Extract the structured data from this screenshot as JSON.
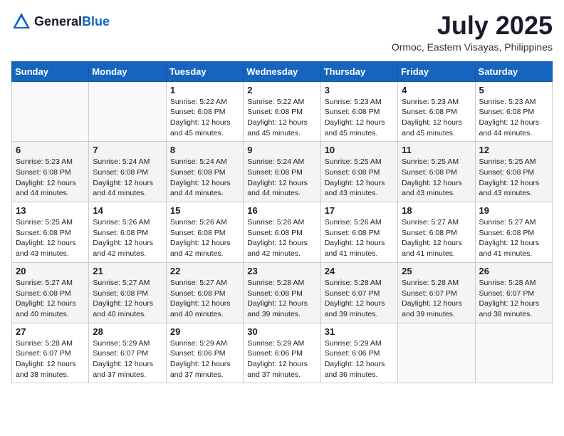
{
  "header": {
    "logo_general": "General",
    "logo_blue": "Blue",
    "month_year": "July 2025",
    "location": "Ormoc, Eastern Visayas, Philippines"
  },
  "columns": [
    "Sunday",
    "Monday",
    "Tuesday",
    "Wednesday",
    "Thursday",
    "Friday",
    "Saturday"
  ],
  "rows": [
    [
      {
        "day": "",
        "detail": ""
      },
      {
        "day": "",
        "detail": ""
      },
      {
        "day": "1",
        "detail": "Sunrise: 5:22 AM\nSunset: 6:08 PM\nDaylight: 12 hours and 45 minutes."
      },
      {
        "day": "2",
        "detail": "Sunrise: 5:22 AM\nSunset: 6:08 PM\nDaylight: 12 hours and 45 minutes."
      },
      {
        "day": "3",
        "detail": "Sunrise: 5:23 AM\nSunset: 6:08 PM\nDaylight: 12 hours and 45 minutes."
      },
      {
        "day": "4",
        "detail": "Sunrise: 5:23 AM\nSunset: 6:08 PM\nDaylight: 12 hours and 45 minutes."
      },
      {
        "day": "5",
        "detail": "Sunrise: 5:23 AM\nSunset: 6:08 PM\nDaylight: 12 hours and 44 minutes."
      }
    ],
    [
      {
        "day": "6",
        "detail": "Sunrise: 5:23 AM\nSunset: 6:08 PM\nDaylight: 12 hours and 44 minutes."
      },
      {
        "day": "7",
        "detail": "Sunrise: 5:24 AM\nSunset: 6:08 PM\nDaylight: 12 hours and 44 minutes."
      },
      {
        "day": "8",
        "detail": "Sunrise: 5:24 AM\nSunset: 6:08 PM\nDaylight: 12 hours and 44 minutes."
      },
      {
        "day": "9",
        "detail": "Sunrise: 5:24 AM\nSunset: 6:08 PM\nDaylight: 12 hours and 44 minutes."
      },
      {
        "day": "10",
        "detail": "Sunrise: 5:25 AM\nSunset: 6:08 PM\nDaylight: 12 hours and 43 minutes."
      },
      {
        "day": "11",
        "detail": "Sunrise: 5:25 AM\nSunset: 6:08 PM\nDaylight: 12 hours and 43 minutes."
      },
      {
        "day": "12",
        "detail": "Sunrise: 5:25 AM\nSunset: 6:08 PM\nDaylight: 12 hours and 43 minutes."
      }
    ],
    [
      {
        "day": "13",
        "detail": "Sunrise: 5:25 AM\nSunset: 6:08 PM\nDaylight: 12 hours and 43 minutes."
      },
      {
        "day": "14",
        "detail": "Sunrise: 5:26 AM\nSunset: 6:08 PM\nDaylight: 12 hours and 42 minutes."
      },
      {
        "day": "15",
        "detail": "Sunrise: 5:26 AM\nSunset: 6:08 PM\nDaylight: 12 hours and 42 minutes."
      },
      {
        "day": "16",
        "detail": "Sunrise: 5:26 AM\nSunset: 6:08 PM\nDaylight: 12 hours and 42 minutes."
      },
      {
        "day": "17",
        "detail": "Sunrise: 5:26 AM\nSunset: 6:08 PM\nDaylight: 12 hours and 41 minutes."
      },
      {
        "day": "18",
        "detail": "Sunrise: 5:27 AM\nSunset: 6:08 PM\nDaylight: 12 hours and 41 minutes."
      },
      {
        "day": "19",
        "detail": "Sunrise: 5:27 AM\nSunset: 6:08 PM\nDaylight: 12 hours and 41 minutes."
      }
    ],
    [
      {
        "day": "20",
        "detail": "Sunrise: 5:27 AM\nSunset: 6:08 PM\nDaylight: 12 hours and 40 minutes."
      },
      {
        "day": "21",
        "detail": "Sunrise: 5:27 AM\nSunset: 6:08 PM\nDaylight: 12 hours and 40 minutes."
      },
      {
        "day": "22",
        "detail": "Sunrise: 5:27 AM\nSunset: 6:08 PM\nDaylight: 12 hours and 40 minutes."
      },
      {
        "day": "23",
        "detail": "Sunrise: 5:28 AM\nSunset: 6:08 PM\nDaylight: 12 hours and 39 minutes."
      },
      {
        "day": "24",
        "detail": "Sunrise: 5:28 AM\nSunset: 6:07 PM\nDaylight: 12 hours and 39 minutes."
      },
      {
        "day": "25",
        "detail": "Sunrise: 5:28 AM\nSunset: 6:07 PM\nDaylight: 12 hours and 39 minutes."
      },
      {
        "day": "26",
        "detail": "Sunrise: 5:28 AM\nSunset: 6:07 PM\nDaylight: 12 hours and 38 minutes."
      }
    ],
    [
      {
        "day": "27",
        "detail": "Sunrise: 5:28 AM\nSunset: 6:07 PM\nDaylight: 12 hours and 38 minutes."
      },
      {
        "day": "28",
        "detail": "Sunrise: 5:29 AM\nSunset: 6:07 PM\nDaylight: 12 hours and 37 minutes."
      },
      {
        "day": "29",
        "detail": "Sunrise: 5:29 AM\nSunset: 6:06 PM\nDaylight: 12 hours and 37 minutes."
      },
      {
        "day": "30",
        "detail": "Sunrise: 5:29 AM\nSunset: 6:06 PM\nDaylight: 12 hours and 37 minutes."
      },
      {
        "day": "31",
        "detail": "Sunrise: 5:29 AM\nSunset: 6:06 PM\nDaylight: 12 hours and 36 minutes."
      },
      {
        "day": "",
        "detail": ""
      },
      {
        "day": "",
        "detail": ""
      }
    ]
  ]
}
